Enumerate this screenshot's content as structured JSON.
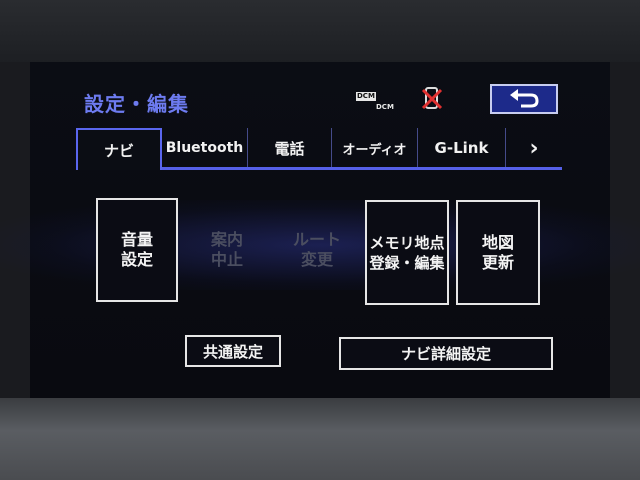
{
  "header": {
    "title": "設定・編集",
    "status_icons": [
      "dcm-icon",
      "phone-disconnected-icon"
    ],
    "back_icon": "return-arrow-icon"
  },
  "tabs": [
    {
      "label": "ナビ",
      "active": true
    },
    {
      "label": "Bluetooth",
      "active": false
    },
    {
      "label": "電話",
      "active": false
    },
    {
      "label": "オーディオ",
      "active": false
    },
    {
      "label": "G-Link",
      "active": false
    },
    {
      "label": "›",
      "active": false
    }
  ],
  "dcm": {
    "line1": "DCM",
    "line2": "DCM"
  },
  "tiles": [
    {
      "line1": "音量",
      "line2": "設定",
      "enabled": true
    },
    {
      "line1": "案内",
      "line2": "中止",
      "enabled": false
    },
    {
      "line1": "ルート",
      "line2": "変更",
      "enabled": false
    },
    {
      "line1": "メモリ地点",
      "line2": "登録・編集",
      "enabled": true
    },
    {
      "line1": "地図",
      "line2": "更新",
      "enabled": true
    }
  ],
  "buttons": {
    "common_settings": "共通設定",
    "navi_detail_settings": "ナビ詳細設定"
  },
  "colors": {
    "accent": "#5a66ee",
    "title": "#6d7bf0",
    "back_button_fill": "#1d2a8a",
    "disabled_text": "#4b4e60"
  }
}
